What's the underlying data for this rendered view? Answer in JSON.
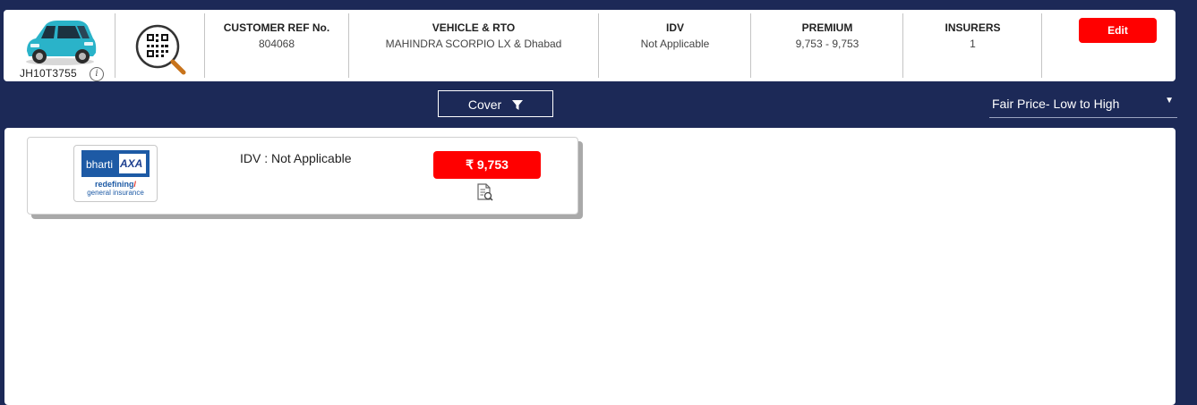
{
  "vehicle": {
    "registration": "JH10T3755",
    "info_icon": "info-icon",
    "image_icon": "car-image"
  },
  "header": {
    "qr_icon": "qr-search-icon",
    "customer_ref": {
      "label": "CUSTOMER REF No.",
      "value": "804068"
    },
    "vehicle_rto": {
      "label": "VEHICLE & RTO",
      "value": "MAHINDRA SCORPIO LX & Dhabad"
    },
    "idv": {
      "label": "IDV",
      "value": "Not Applicable"
    },
    "premium": {
      "label": "PREMIUM",
      "value": "9,753 - 9,753"
    },
    "insurers": {
      "label": "INSURERS",
      "value": "1"
    },
    "edit_label": "Edit"
  },
  "filters": {
    "cover_label": "Cover",
    "cover_icon": "filter-icon",
    "sort_selected": "Fair Price- Low to High"
  },
  "quotes": [
    {
      "insurer_logo": {
        "brand": "bharti",
        "partner": "AXA",
        "tagline_1": "redefining",
        "tagline_2": "general insurance"
      },
      "idv_text": "IDV : Not Applicable",
      "price": "₹ 9,753",
      "doc_icon": "document-search-icon"
    }
  ],
  "colors": {
    "background": "#1c2957",
    "accent": "#ff0000",
    "insurer_blue": "#1d5aa5"
  }
}
